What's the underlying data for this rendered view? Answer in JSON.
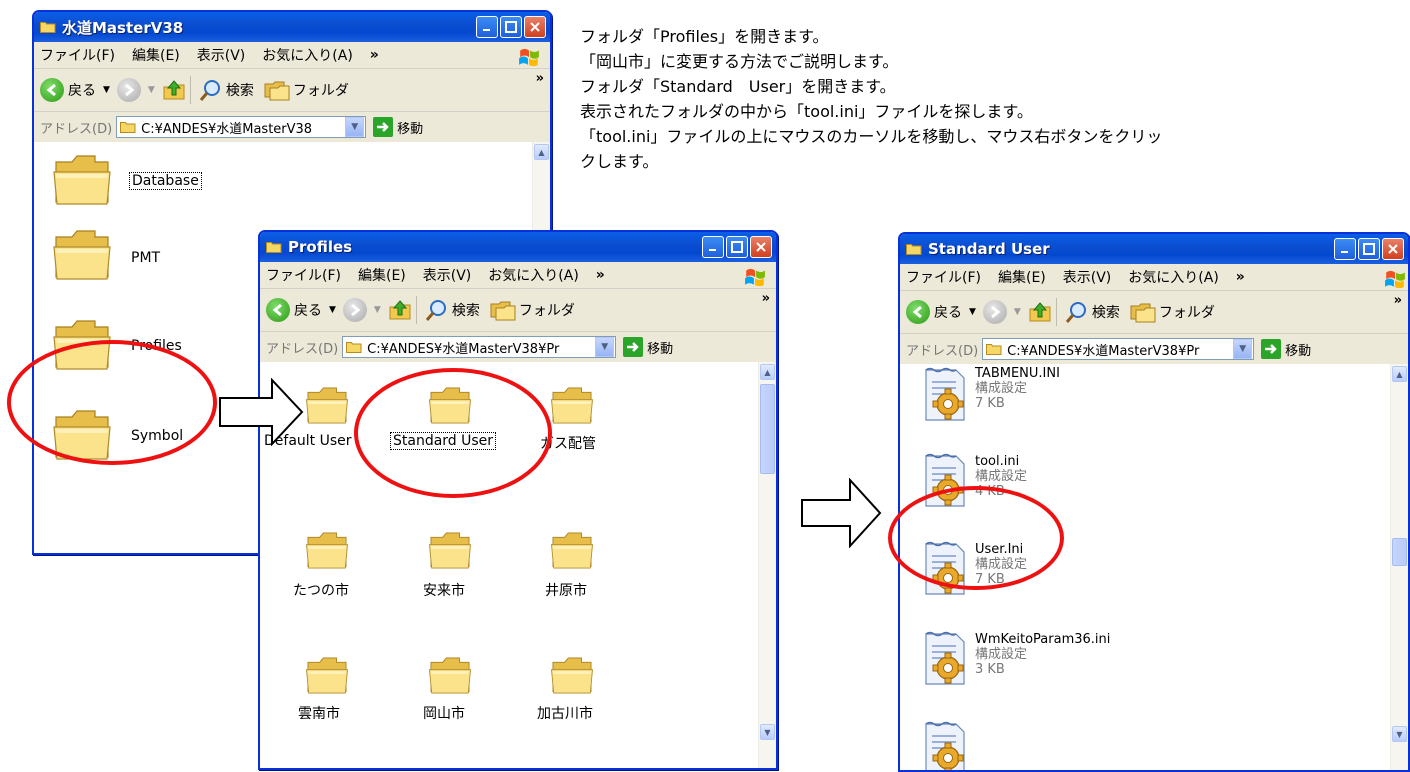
{
  "menu": {
    "file": "ファイル(F)",
    "edit": "編集(E)",
    "view": "表示(V)",
    "favorites": "お気に入り(A)",
    "more": "»"
  },
  "toolbar": {
    "back": "戻る",
    "search": "検索",
    "folders": "フォルダ",
    "more": "»"
  },
  "address": {
    "label": "アドレス(D)",
    "go": "移動"
  },
  "window_main": {
    "title": "水道MasterV38",
    "path": "C:¥ANDES¥水道MasterV38",
    "items": [
      "Database",
      "PMT",
      "Profiles",
      "Symbol"
    ]
  },
  "window_profiles": {
    "title": "Profiles",
    "path": "C:¥ANDES¥水道MasterV38¥Pr",
    "items": [
      "Default User",
      "Standard User",
      "ガス配管",
      "たつの市",
      "安来市",
      "井原市",
      "雲南市",
      "岡山市",
      "加古川市"
    ]
  },
  "window_standard": {
    "title": "Standard User",
    "path": "C:¥ANDES¥水道MasterV38¥Pr",
    "files": [
      {
        "name": "TABMENU.INI",
        "type": "構成設定",
        "size": "7 KB"
      },
      {
        "name": "tool.ini",
        "type": "構成設定",
        "size": "4 KB"
      },
      {
        "name": "User.Ini",
        "type": "構成設定",
        "size": "7 KB"
      },
      {
        "name": "WmKeitoParam36.ini",
        "type": "構成設定",
        "size": "3 KB"
      }
    ]
  },
  "instructions": [
    "フォルダ「Profiles」を開きます。",
    "「岡山市」に変更する方法でご説明します。",
    "フォルダ「Standard　User」を開きます。",
    "表示されたフォルダの中から「tool.ini」ファイルを探します。",
    "「tool.ini」ファイルの上にマウスのカーソルを移動し、マウス右ボタンをクリッ",
    "クします。"
  ],
  "colors": {
    "titlebar": "#0b4ed1",
    "highlight_oval": "#ee1111",
    "folder": "#f6d46b"
  }
}
